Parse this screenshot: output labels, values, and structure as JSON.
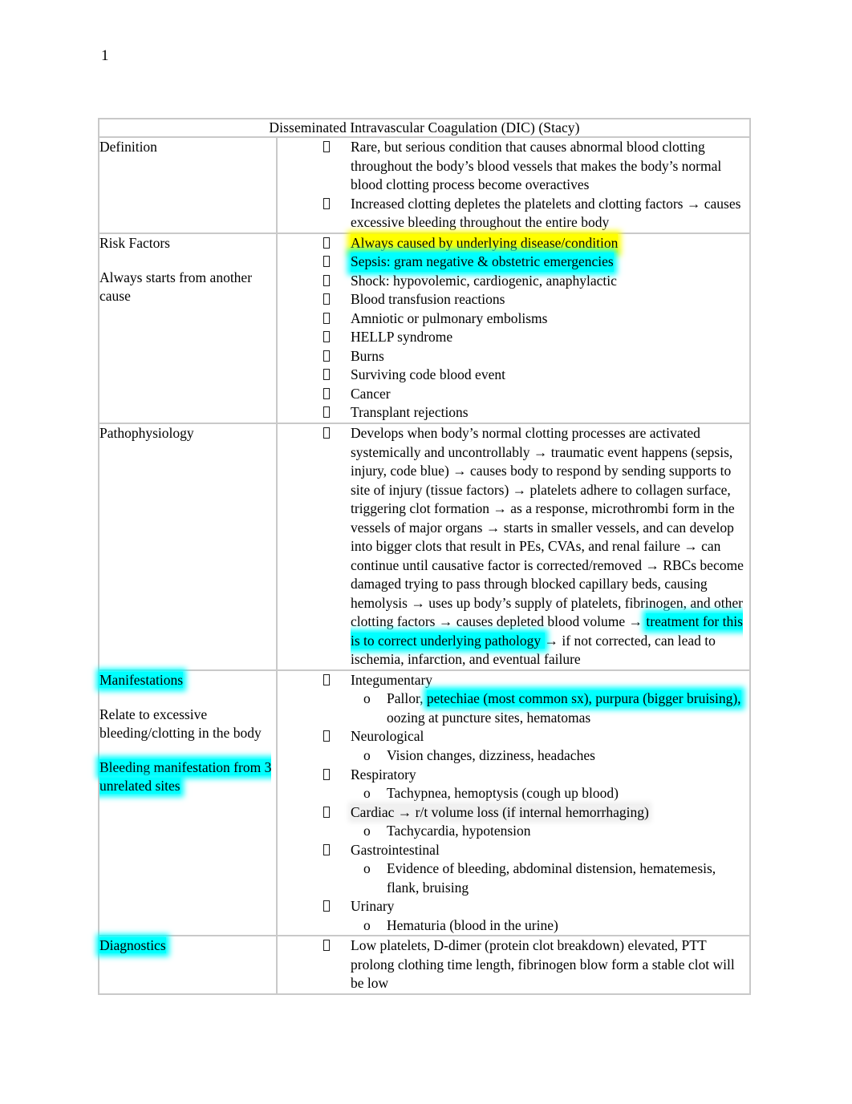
{
  "page": {
    "number": "1"
  },
  "table": {
    "title": "Disseminated Intravascular Coagulation (DIC) (Stacy)",
    "rows": {
      "definition": {
        "label": "Definition",
        "bullets": [
          " Rare, but serious condition that causes abnormal   blood clotting throughout the body’s   blood vessels that makes the body’s normal blood clotting process become overactives",
          " Increased clotting depletes the platelets and clotting factors → causes excessive bleeding throughout the entire body"
        ]
      },
      "risk_factors": {
        "label": "Risk Factors",
        "label_note": "Always starts from another cause",
        "bullets": [
          "Always caused by underlying disease/condition",
          "Sepsis:  gram negative & obstetric emergencies",
          " Shock: hypovolemic, cardiogenic, anaphylactic",
          "Blood transfusion reactions",
          "Amniotic or pulmonary embolisms",
          " HELLP syndrome",
          "Burns",
          "Surviving code blood event",
          "Cancer",
          "Transplant rejections"
        ]
      },
      "pathophysiology": {
        "label": "Pathophysiology",
        "text_before": "Develops when body’s normal clotting processes are activated systemically and uncontrollably → traumatic event happens (sepsis, injury, code blue) → causes body to respond by sending supports to site of injury (tissue factors) → platelets adhere to collagen surface, triggering clot formation → as a response, microthrombi form in the vessels of major organs → starts in smaller vessels, and can develop into bigger clots that result in PEs, CVAs, and renal failure → can continue until causative factor is corrected/removed → RBCs become damaged trying to pass through blocked capillary beds, causing hemolysis → uses up body’s supply of platelets, fibrinogen, and other clotting factors → causes depleted blood volume → ",
        "text_highlight": "treatment for this is to correct underlying pathology ",
        "text_after": " → if not corrected, can lead to ischemia, infarction, and eventual failure"
      },
      "manifestations": {
        "label": "Manifestations",
        "label_note": "Relate to excessive bleeding/clotting in the body",
        "label_note2": "Bleeding manifestation from 3 unrelated sites",
        "groups": [
          {
            "heading": "Integumentary",
            "heading_shaded": false,
            "sub": [
              {
                "plain_before": "Pallor, ",
                "highlight": "petechiae (most common sx),   purpura (bigger bruising),",
                "plain_after": " oozing at puncture sites, hematomas"
              }
            ]
          },
          {
            "heading": "Neurological",
            "heading_shaded": false,
            "sub": [
              {
                "plain_before": "Vision changes, dizziness, headaches",
                "highlight": "",
                "plain_after": ""
              }
            ]
          },
          {
            "heading": "Respiratory",
            "heading_shaded": false,
            "sub": [
              {
                "plain_before": "Tachypnea, hemoptysis (cough up blood)",
                "highlight": "",
                "plain_after": ""
              }
            ]
          },
          {
            "heading": "Cardiac → r/t volume loss (if internal hemorrhaging)",
            "heading_shaded": true,
            "sub": [
              {
                "plain_before": "Tachycardia, hypotension",
                "highlight": "",
                "plain_after": ""
              }
            ]
          },
          {
            "heading": "Gastrointestinal",
            "heading_shaded": false,
            "sub": [
              {
                "plain_before": " Evidence of bleeding, abdominal distension, hematemesis, flank, bruising",
                "highlight": "",
                "plain_after": ""
              }
            ]
          },
          {
            "heading": "Urinary",
            "heading_shaded": false,
            "sub": [
              {
                "plain_before": "Hematuria (blood in the urine)",
                "highlight": "",
                "plain_after": ""
              }
            ]
          }
        ],
        "sub_marker": "o"
      },
      "diagnostics": {
        "label": "Diagnostics",
        "bullets": [
          "Low platelets, D-dimer (protein clot breakdown) elevated, PTT prolong clothing time length, fibrinogen blow form a stable clot will be low"
        ]
      }
    }
  },
  "colors": {
    "highlight_yellow": "#FFFF00",
    "highlight_cyan": "#00FFFF",
    "border_gray": "#C9C9C9",
    "text": "#000000"
  }
}
